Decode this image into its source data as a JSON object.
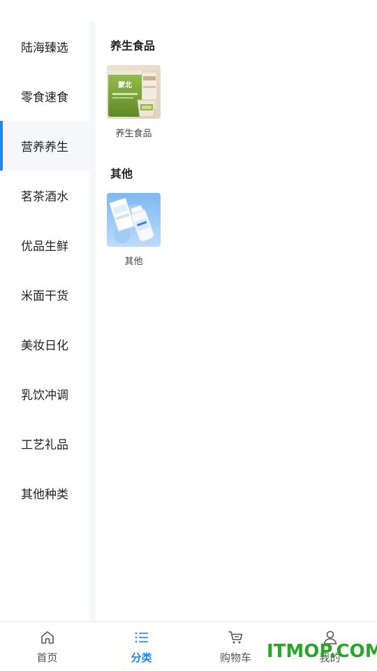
{
  "sidebar": {
    "items": [
      {
        "label": "陆海臻选"
      },
      {
        "label": "零食速食"
      },
      {
        "label": "营养养生"
      },
      {
        "label": "茗茶酒水"
      },
      {
        "label": "优品生鲜"
      },
      {
        "label": "米面干货"
      },
      {
        "label": "美妆日化"
      },
      {
        "label": "乳饮冲调"
      },
      {
        "label": "工艺礼品"
      },
      {
        "label": "其他种类"
      }
    ],
    "active_index": 2
  },
  "content": {
    "sections": [
      {
        "title": "养生食品",
        "products": [
          {
            "label": "养生食品",
            "thumb_icon": "mengbei-product-image",
            "brand": "蒙北"
          }
        ]
      },
      {
        "title": "其他",
        "products": [
          {
            "label": "其他",
            "thumb_icon": "milk-bottle-product-image"
          }
        ]
      }
    ]
  },
  "tabbar": {
    "tabs": [
      {
        "label": "首页",
        "icon": "home-icon"
      },
      {
        "label": "分类",
        "icon": "list-icon",
        "active": true
      },
      {
        "label": "购物车",
        "icon": "cart-icon"
      },
      {
        "label": "我的",
        "icon": "user-icon"
      }
    ]
  },
  "watermark": "ITMOP.COM",
  "colors": {
    "accent": "#1989fa",
    "sidebar_active_bg": "#f5f7fb",
    "watermark": "#2aa52a"
  }
}
